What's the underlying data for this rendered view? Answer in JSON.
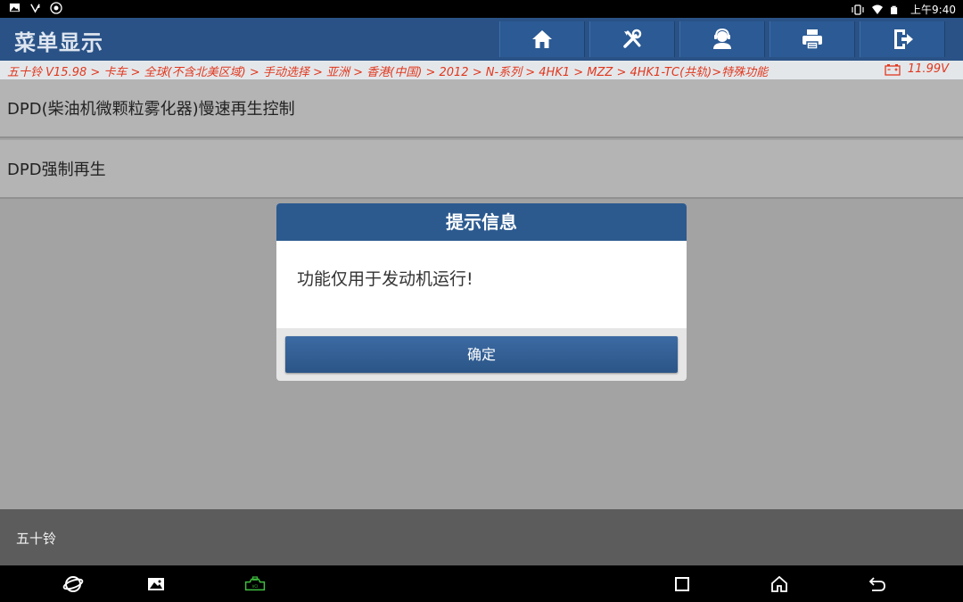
{
  "status_bar": {
    "time": "上午9:40",
    "left_icons": [
      "image-icon",
      "voicemail-icon",
      "usb-debug-icon"
    ],
    "right_icons": [
      "vibrate-icon",
      "wifi-icon",
      "battery-icon"
    ]
  },
  "header": {
    "title": "菜单显示",
    "toolbar": [
      "home-icon",
      "diagnose-tools-icon",
      "support-agent-icon",
      "print-icon",
      "exit-icon"
    ]
  },
  "breadcrumb": {
    "path": "五十铃 V15.98 > 卡车 > 全球(不含北美区域) > 手动选择 > 亚洲 > 香港(中国) > 2012 > N-系列 > 4HK1 > MZZ > 4HK1-TC(共轨)>特殊功能",
    "voltage": "11.99V"
  },
  "menu": {
    "items": [
      {
        "label": "DPD(柴油机微颗粒雾化器)慢速再生控制"
      },
      {
        "label": "DPD强制再生"
      }
    ]
  },
  "dialog": {
    "title": "提示信息",
    "message": "功能仅用于发动机运行!",
    "ok_label": "确定"
  },
  "footer": {
    "label": "五十铃"
  },
  "nav_bar": {
    "buttons": [
      "browser-icon",
      "gallery-icon",
      "vci-icon",
      "recents-icon",
      "home-nav-icon",
      "back-icon"
    ]
  },
  "colors": {
    "header_bg": "#2a5286",
    "breadcrumb_text": "#e0381f",
    "dialog_title_bg": "#2c5a8f",
    "vci_green": "#3fbf3f"
  }
}
